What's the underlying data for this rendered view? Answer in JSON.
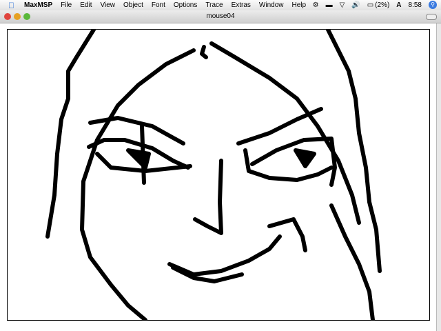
{
  "menubar": {
    "app": "MaxMSP",
    "items": [
      "File",
      "Edit",
      "View",
      "Object",
      "Font",
      "Options",
      "Trace",
      "Extras",
      "Window",
      "Help"
    ],
    "battery": "(2%)",
    "clock": "8:58",
    "input_menu": "A"
  },
  "window": {
    "title": "mouse04"
  }
}
